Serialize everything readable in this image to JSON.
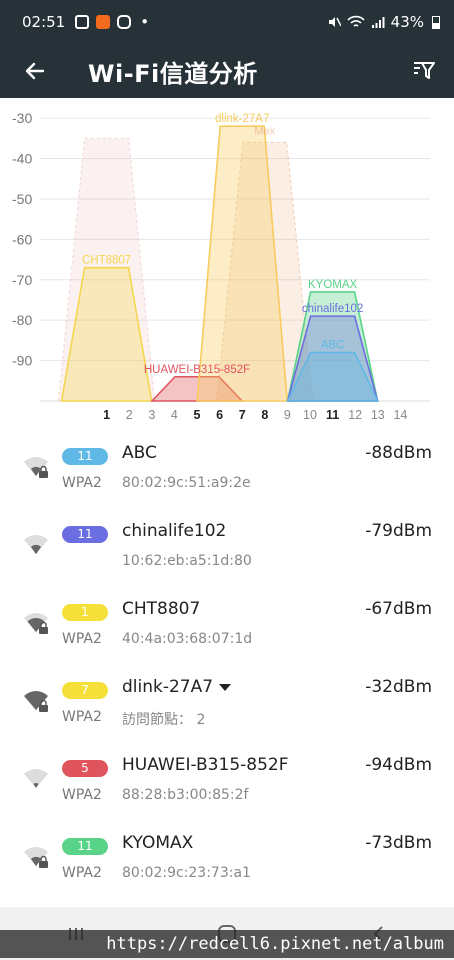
{
  "status_bar": {
    "time": "02:51",
    "dot": "•",
    "battery": "43%"
  },
  "app_bar": {
    "title": "Wi-Fi信道分析",
    "back_icon": "back-arrow-icon",
    "filter_icon": "filter-icon"
  },
  "chart_data": {
    "type": "area",
    "ylim": [
      -100,
      -27
    ],
    "yticks": [
      -30,
      -40,
      -50,
      -60,
      -70,
      -80,
      -90
    ],
    "channels": [
      1,
      2,
      3,
      4,
      5,
      6,
      7,
      8,
      9,
      10,
      11,
      12,
      13,
      14
    ],
    "bold_channels": [
      1,
      5,
      6,
      7,
      8,
      11
    ],
    "series": [
      {
        "name": "CHT8807",
        "channel": 1,
        "level": -67,
        "color": "#f5d64f"
      },
      {
        "name": "HUAWEI-B315-852F",
        "channel": 5,
        "level": -94,
        "color": "#e0545d"
      },
      {
        "name": "dlink-27A7",
        "channel": 7,
        "level": -32,
        "color": "#f7cb5e"
      },
      {
        "name": "KYOMAX",
        "channel": 11,
        "level": -73,
        "color": "#59d388"
      },
      {
        "name": "chinalife102",
        "channel": 11,
        "level": -79,
        "color": "#6a6ee0"
      },
      {
        "name": "ABC",
        "channel": 11,
        "level": -88,
        "color": "#5fb8e6"
      }
    ],
    "ghost_series": [
      {
        "channel": 1,
        "level": -35,
        "color": "#e8b0b0"
      },
      {
        "channel": 8,
        "level": -36,
        "color": "#e8a070"
      }
    ],
    "partial_labels": [
      {
        "text": "Mex",
        "channel": 8,
        "level": -34,
        "color": "#e8a070"
      }
    ]
  },
  "networks": [
    {
      "channel": "11",
      "badge_color": "#5fb8e6",
      "ssid": "ABC",
      "dbm": "-88dBm",
      "security": "WPA2",
      "mac": "80:02:9c:51:a9:2e",
      "locked": true,
      "signal": 1
    },
    {
      "channel": "11",
      "badge_color": "#6a6ee0",
      "ssid": "chinalife102",
      "dbm": "-79dBm",
      "security": "",
      "mac": "10:62:eb:a5:1d:80",
      "locked": false,
      "signal": 1
    },
    {
      "channel": "1",
      "badge_color": "#f5e03a",
      "ssid": "CHT8807",
      "dbm": "-67dBm",
      "security": "WPA2",
      "mac": "40:4a:03:68:07:1d",
      "locked": true,
      "signal": 2
    },
    {
      "channel": "7",
      "badge_color": "#f5e03a",
      "ssid": "dlink-27A7",
      "dbm": "-32dBm",
      "security": "WPA2",
      "mac": "訪問節點： 2",
      "locked": true,
      "signal": 3,
      "expandable": true
    },
    {
      "channel": "5",
      "badge_color": "#e0545d",
      "ssid": "HUAWEI-B315-852F",
      "dbm": "-94dBm",
      "security": "WPA2",
      "mac": "88:28:b3:00:85:2f",
      "locked": false,
      "signal": 0
    },
    {
      "channel": "11",
      "badge_color": "#59d388",
      "ssid": "KYOMAX",
      "dbm": "-73dBm",
      "security": "WPA2",
      "mac": "80:02:9c:23:73:a1",
      "locked": true,
      "signal": 1
    }
  ],
  "watermark": "https://redcell6.pixnet.net/album"
}
